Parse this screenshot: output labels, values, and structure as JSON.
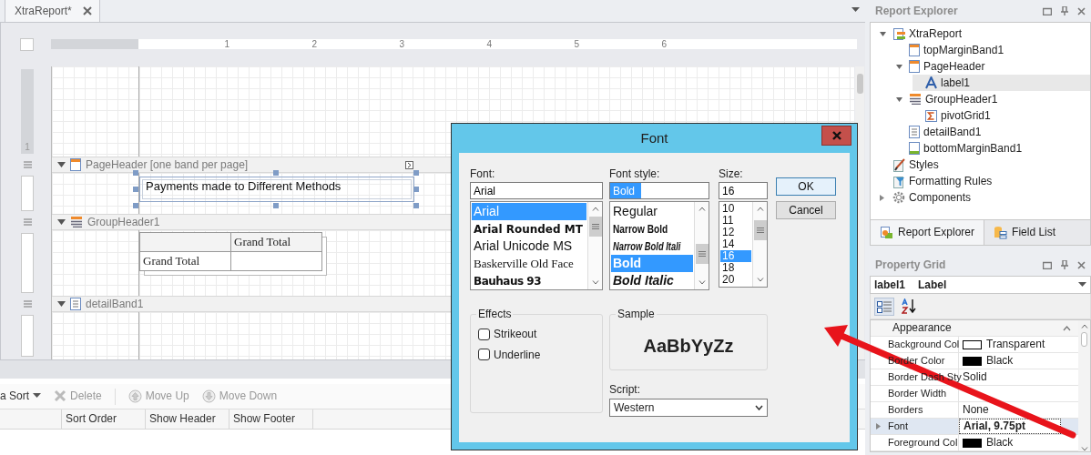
{
  "document_tab": {
    "title": "XtraReport*",
    "selected": true
  },
  "ruler": {
    "marks": [
      "1",
      "2",
      "3",
      "4",
      "5",
      "6"
    ],
    "side_mark": "1"
  },
  "bands": [
    {
      "kind": "top_margin"
    },
    {
      "kind": "page_header",
      "title": "PageHeader [one band per page]",
      "expanded": true,
      "label": {
        "text": "Payments made to Different Methods",
        "selected": true
      }
    },
    {
      "kind": "group_header",
      "title": "GroupHeader1",
      "expanded": true,
      "pivot": {
        "column_header": "Grand Total",
        "row_header": "Grand Total"
      }
    },
    {
      "kind": "detail",
      "title": "detailBand1",
      "expanded": true
    }
  ],
  "sorting": {
    "toolbar": [
      {
        "label": "a Sort",
        "kind": "dropdown",
        "disabled": false
      },
      {
        "label": "Delete",
        "kind": "delete",
        "disabled": true
      },
      {
        "label": "Move Up",
        "kind": "up",
        "disabled": true
      },
      {
        "label": "Move Down",
        "kind": "down",
        "disabled": true
      }
    ],
    "columns": [
      "Sort Order",
      "Show Header",
      "Show Footer"
    ]
  },
  "report_explorer": {
    "title": "Report Explorer",
    "tree": [
      {
        "label": "XtraReport",
        "kind": "report",
        "expanded": true,
        "selected": false,
        "children": [
          {
            "label": "topMarginBand1",
            "kind": "band-top",
            "selected": false
          },
          {
            "label": "PageHeader",
            "kind": "band-header",
            "expanded": true,
            "selected": false,
            "children": [
              {
                "label": "label1",
                "kind": "label",
                "selected": true
              }
            ]
          },
          {
            "label": "GroupHeader1",
            "kind": "band-group",
            "expanded": true,
            "selected": false,
            "children": [
              {
                "label": "pivotGrid1",
                "kind": "pivot",
                "selected": false
              }
            ]
          },
          {
            "label": "detailBand1",
            "kind": "band-detail",
            "selected": false
          },
          {
            "label": "bottomMarginBand1",
            "kind": "band-bottom",
            "selected": false
          }
        ]
      },
      {
        "label": "Styles",
        "kind": "styles",
        "selected": false
      },
      {
        "label": "Formatting Rules",
        "kind": "rules",
        "selected": false
      },
      {
        "label": "Components",
        "kind": "components",
        "expanded": false,
        "selected": false
      }
    ],
    "tabs": [
      {
        "label": "Report Explorer",
        "kind": "explorer",
        "selected": true
      },
      {
        "label": "Field List",
        "kind": "fields",
        "selected": false
      }
    ]
  },
  "property_grid": {
    "title": "Property Grid",
    "object_name": "label1",
    "object_type": "Label",
    "rows": [
      {
        "kind": "category",
        "label": "Appearance",
        "expanded": true
      },
      {
        "kind": "property",
        "label": "Background Col",
        "value": "Transparent",
        "color": "#ffffff",
        "selected": false
      },
      {
        "kind": "property",
        "label": "Border Color",
        "value": "Black",
        "color": "#000000",
        "selected": false
      },
      {
        "kind": "property",
        "label": "Border Dash Sty",
        "value": "Solid",
        "selected": false
      },
      {
        "kind": "property",
        "label": "Border Width",
        "selected": false
      },
      {
        "kind": "property",
        "label": "Borders",
        "value": "None",
        "selected": false
      },
      {
        "kind": "composite",
        "label": "Font",
        "value": "Arial, 9.75pt",
        "selected": true
      },
      {
        "kind": "property",
        "label": "Foreground Col",
        "value": "Black",
        "color": "#000000",
        "selected": false
      }
    ]
  },
  "font_dialog": {
    "title": "Font",
    "font_label": "Font:",
    "font_value": "Arial",
    "fonts": [
      {
        "name": "Arial",
        "kind": "sans",
        "selected": true
      },
      {
        "name": "Arial Rounded MT",
        "kind": "rounded",
        "selected": false
      },
      {
        "name": "Arial Unicode MS",
        "kind": "sans",
        "selected": false
      },
      {
        "name": "Baskerville Old Face",
        "kind": "serif",
        "selected": false
      },
      {
        "name": "Bauhaus 93",
        "kind": "display",
        "selected": false
      }
    ],
    "style_label": "Font style:",
    "style_value": "Bold",
    "styles": [
      {
        "name": "Regular",
        "kind": "regular",
        "selected": false
      },
      {
        "name": "Narrow Bold",
        "kind": "narrow-bold",
        "selected": false
      },
      {
        "name": "Narrow Bold Itali",
        "kind": "narrow-bold-italic",
        "selected": false
      },
      {
        "name": "Bold",
        "kind": "bold",
        "selected": true
      },
      {
        "name": "Bold Italic",
        "kind": "bold-italic",
        "selected": false
      }
    ],
    "size_label": "Size:",
    "size_value": "16",
    "sizes": [
      {
        "name": "10",
        "selected": false
      },
      {
        "name": "11",
        "selected": false
      },
      {
        "name": "12",
        "selected": false
      },
      {
        "name": "14",
        "selected": false
      },
      {
        "name": "16",
        "selected": true
      },
      {
        "name": "18",
        "selected": false
      },
      {
        "name": "20",
        "selected": false
      }
    ],
    "buttons": [
      {
        "label": "OK",
        "default": true
      },
      {
        "label": "Cancel",
        "default": false
      }
    ],
    "effects": {
      "title": "Effects",
      "options": [
        {
          "label": "Strikeout",
          "checked": false
        },
        {
          "label": "Underline",
          "checked": false
        }
      ]
    },
    "sample": {
      "title": "Sample",
      "text": "AaBbYyZz"
    },
    "script": {
      "label": "Script:",
      "value": "Western"
    }
  }
}
